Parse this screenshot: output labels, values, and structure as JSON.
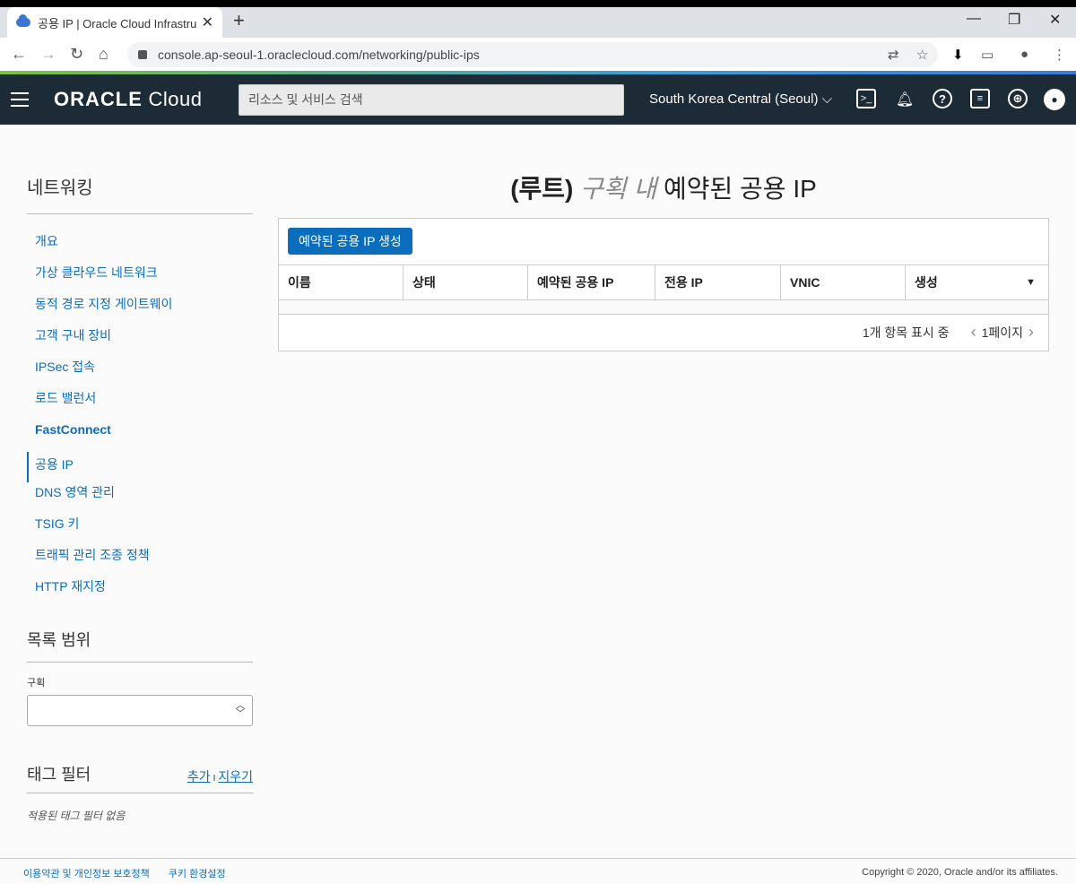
{
  "browser": {
    "tab_title": "공용 IP | Oracle Cloud Infrastruc",
    "url": "console.ap-seoul-1.oraclecloud.com/networking/public-ips"
  },
  "header": {
    "logo_bold": "ORACLE",
    "logo_rest": " Cloud",
    "search_placeholder": "리소스 및 서비스 검색",
    "region": "South Korea Central (Seoul)"
  },
  "sidebar": {
    "title": "네트워킹",
    "items": [
      {
        "label": "개요"
      },
      {
        "label": "가상 클라우드 네트워크"
      },
      {
        "label": "동적 경로 지정 게이트웨이"
      },
      {
        "label": "고객 구내 장비"
      },
      {
        "label": "IPSec 접속"
      },
      {
        "label": "로드 밸런서"
      },
      {
        "label": "FastConnect"
      },
      {
        "label": "공용 IP"
      },
      {
        "label": "DNS 영역 관리"
      },
      {
        "label": "TSIG 키"
      },
      {
        "label": "트래픽 관리 조종 정책"
      },
      {
        "label": "HTTP 재지정"
      }
    ],
    "scope_title": "목록 범위",
    "compartment_label": "구획",
    "tag_filter_title": "태그 필터",
    "tag_add": "추가",
    "tag_separator": "I",
    "tag_clear": "지우기",
    "tag_empty": "적용된 태그 필터 없음"
  },
  "main": {
    "title_root": "(루트)",
    "title_compartment": " 구획 내 ",
    "title_rest": "예약된 공용 IP",
    "create_button": "예약된 공용 IP 생성",
    "columns": [
      "이름",
      "상태",
      "예약된 공용 IP",
      "전용 IP",
      "VNIC",
      "생성"
    ],
    "sort_indicator": "▼",
    "items_shown": "1개 항목 표시 중",
    "page": "1페이지"
  },
  "footer": {
    "terms": "이용약관 및 개인정보 보호정책",
    "cookies": "쿠키 환경설정",
    "copyright": "Copyright © 2020, Oracle and/or its affiliates."
  }
}
